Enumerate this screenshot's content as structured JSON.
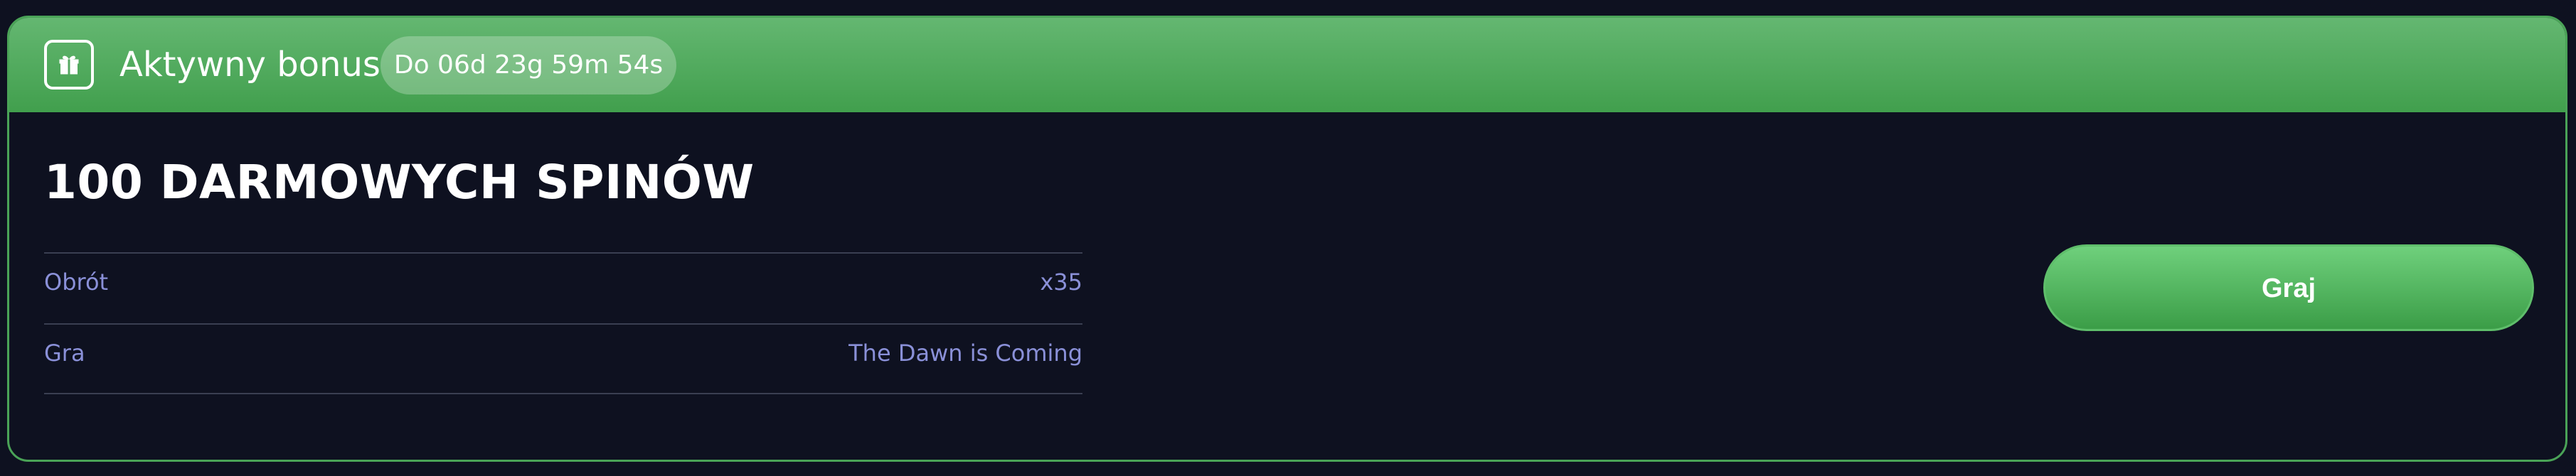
{
  "header": {
    "icon": "gift-icon",
    "title": "Aktywny bonus",
    "timer": "Do 06d 23g 59m 54s"
  },
  "bonus": {
    "title": "100 DARMOWYCH SPINÓW",
    "details": [
      {
        "label": "Obrót",
        "value": "x35"
      },
      {
        "label": "Gra",
        "value": "The Dawn is Coming"
      }
    ]
  },
  "actions": {
    "play_label": "Graj"
  },
  "colors": {
    "background": "#0e1120",
    "accent_green": "#4aa357",
    "detail_text": "#8a90d8"
  }
}
